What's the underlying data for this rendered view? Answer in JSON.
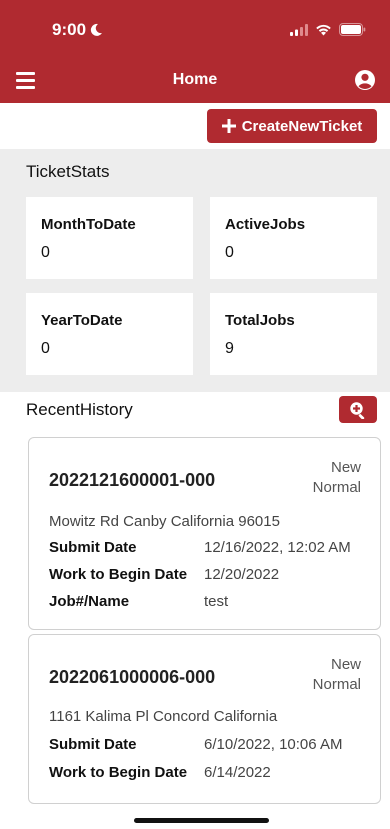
{
  "status_bar": {
    "time": "9:00"
  },
  "header": {
    "title": "Home"
  },
  "toolbar": {
    "new_ticket_label": "CreateNewTicket"
  },
  "stats": {
    "title": "TicketStats",
    "cards": [
      {
        "label": "MonthToDate",
        "value": "0"
      },
      {
        "label": "ActiveJobs",
        "value": "0"
      },
      {
        "label": "YearToDate",
        "value": "0"
      },
      {
        "label": "TotalJobs",
        "value": "9"
      }
    ]
  },
  "history": {
    "title": "RecentHistory",
    "tickets": [
      {
        "number": "2022121600001-000",
        "status_line1": "New",
        "status_line2": "Normal",
        "address": "Mowitz Rd Canby California 96015",
        "submit_label": "Submit Date",
        "submit_value": "12/16/2022, 12:02 AM",
        "work_label": "Work to Begin Date",
        "work_value": "12/20/2022",
        "job_label": "Job#/Name",
        "job_value": "test"
      },
      {
        "number": "2022061000006-000",
        "status_line1": "New",
        "status_line2": "Normal",
        "address": "1161 Kalima Pl Concord California",
        "submit_label": "Submit Date",
        "submit_value": "6/10/2022, 10:06 AM",
        "work_label": "Work to Begin Date",
        "work_value": "6/14/2022"
      }
    ]
  },
  "colors": {
    "brand": "#b02a30",
    "stats_bg": "#ededed"
  },
  "icons": [
    "moon-icon",
    "signal-icon",
    "wifi-icon",
    "battery-icon",
    "menu-icon",
    "account-icon",
    "plus-icon",
    "zoom-in-icon"
  ]
}
